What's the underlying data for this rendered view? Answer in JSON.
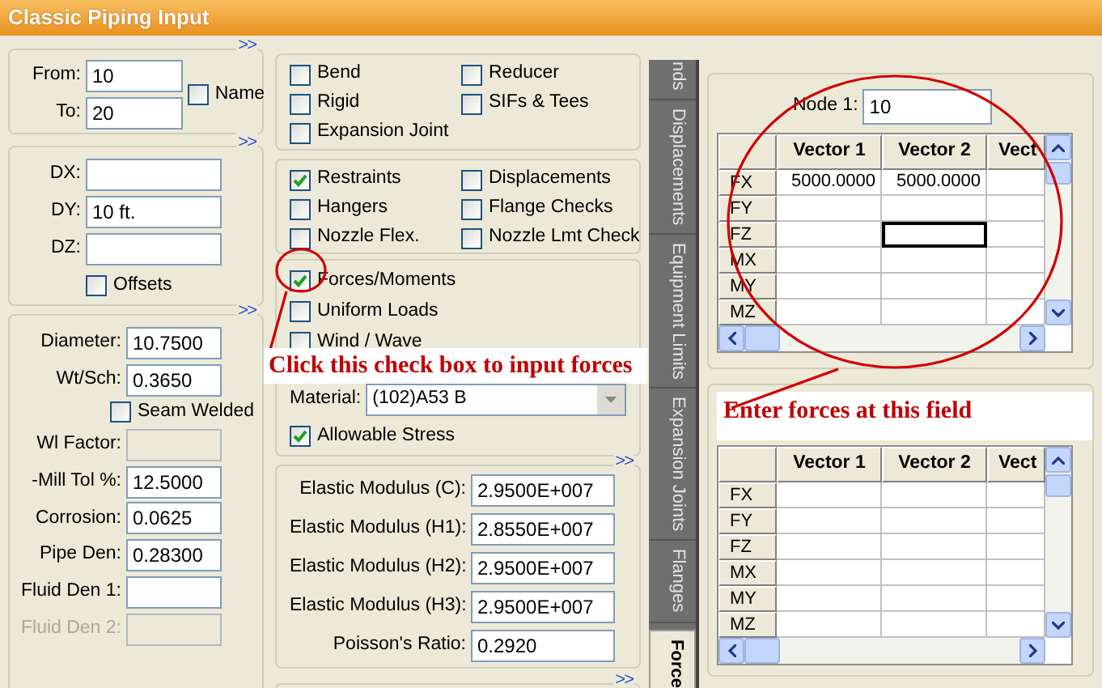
{
  "window": {
    "title": "Classic Piping Input"
  },
  "node_panel": {
    "expand": ">>",
    "fields": [
      {
        "label": "From:",
        "value": "10"
      },
      {
        "label": "To:",
        "value": "20"
      }
    ],
    "name_checkbox": {
      "label": "Name",
      "checked": false
    }
  },
  "offset_panel": {
    "expand": ">>",
    "fields": [
      {
        "label": "DX:"
      },
      {
        "label": "DY:",
        "value": "10 ft."
      },
      {
        "label": "DZ:"
      }
    ],
    "offsets_checkbox": {
      "label": "Offsets",
      "checked": false
    }
  },
  "pipe_panel": {
    "expand": ">>",
    "rows": [
      {
        "kind": "field",
        "label": "Diameter:",
        "value": "10.7500",
        "disabled": false,
        "label_dimmed": false
      },
      {
        "kind": "field",
        "label": "Wt/Sch:",
        "value": "0.3650",
        "disabled": false,
        "label_dimmed": false
      },
      {
        "kind": "checkbox",
        "label": "Seam Welded",
        "checked": false
      },
      {
        "kind": "field",
        "label": "Wl Factor:",
        "disabled": true,
        "label_dimmed": false
      },
      {
        "kind": "field",
        "label": "-Mill Tol %:",
        "value": "12.5000",
        "disabled": false,
        "label_dimmed": false
      },
      {
        "kind": "field",
        "label": "Corrosion:",
        "value": "0.0625",
        "disabled": false,
        "label_dimmed": false
      },
      {
        "kind": "field",
        "label": "Pipe Den:",
        "value": "0.28300",
        "disabled": false,
        "label_dimmed": false
      },
      {
        "kind": "field",
        "label": "Fluid Den 1:",
        "disabled": false,
        "label_dimmed": false
      },
      {
        "kind": "field",
        "label": "Fluid Den 2:",
        "disabled": true,
        "label_dimmed": true
      }
    ]
  },
  "element_options": [
    {
      "label": "Bend",
      "checked": false
    },
    {
      "label": "Reducer",
      "checked": false
    },
    {
      "label": "Rigid",
      "checked": false
    },
    {
      "label": "SIFs & Tees",
      "checked": false
    },
    {
      "label": "Expansion Joint",
      "checked": false
    }
  ],
  "boundary_options": [
    {
      "label": "Restraints",
      "checked": true
    },
    {
      "label": "Displacements",
      "checked": false
    },
    {
      "label": "Hangers",
      "checked": false
    },
    {
      "label": "Flange Checks",
      "checked": false
    },
    {
      "label": "Nozzle Flex.",
      "checked": false
    },
    {
      "label": "Nozzle Lmt Check",
      "checked": false
    }
  ],
  "load_options": [
    {
      "label": "Forces/Moments",
      "checked": true
    },
    {
      "label": "Uniform Loads",
      "checked": false
    },
    {
      "label": "Wind / Wave",
      "checked": false
    }
  ],
  "material": {
    "label": "Material:",
    "value": "(102)A53 B"
  },
  "allowable_stress": {
    "label": "Allowable Stress",
    "checked": true
  },
  "modulus_panel": {
    "expand": ">>",
    "fields": [
      {
        "label": "Elastic Modulus (C):",
        "value": "2.9500E+007"
      },
      {
        "label": "Elastic Modulus (H1):",
        "value": "2.8550E+007"
      },
      {
        "label": "Elastic Modulus (H2):",
        "value": "2.9500E+007"
      },
      {
        "label": "Elastic Modulus (H3):",
        "value": "2.9500E+007"
      },
      {
        "label": "Poisson's Ratio:",
        "value": "0.2920"
      }
    ]
  },
  "next_panel": {
    "expand": ">>"
  },
  "side_tabs": [
    {
      "label": "nds",
      "selected": false
    },
    {
      "label": "Displacements",
      "selected": false
    },
    {
      "label": "Equipment Limits",
      "selected": false
    },
    {
      "label": "Expansion Joints",
      "selected": false
    },
    {
      "label": "Flanges",
      "selected": false
    },
    {
      "label": "Force",
      "selected": true
    }
  ],
  "load_table": {
    "node_label": "Node 1:",
    "node_value": "10",
    "columns": [
      "Vector 1",
      "Vector 2",
      "Vect"
    ],
    "rows": [
      {
        "label": "FX",
        "cells": [
          {
            "value": "5000.0000",
            "focused": false
          },
          {
            "value": "5000.0000",
            "focused": false
          },
          {
            "focused": false
          }
        ]
      },
      {
        "label": "FY",
        "cells": [
          {
            "focused": false
          },
          {
            "focused": false
          },
          {
            "focused": false
          }
        ]
      },
      {
        "label": "FZ",
        "cells": [
          {
            "focused": false
          },
          {
            "focused": true
          },
          {
            "focused": false
          }
        ]
      },
      {
        "label": "MX",
        "cells": [
          {
            "focused": false
          },
          {
            "focused": false
          },
          {
            "focused": false
          }
        ]
      },
      {
        "label": "MY",
        "cells": [
          {
            "focused": false
          },
          {
            "focused": false
          },
          {
            "focused": false
          }
        ]
      },
      {
        "label": "MZ",
        "cells": [
          {
            "focused": false
          },
          {
            "focused": false
          },
          {
            "focused": false
          }
        ]
      }
    ]
  },
  "second_table": {
    "columns": [
      "Vector 1",
      "Vector 2",
      "Vect"
    ],
    "rows": [
      {
        "label": "FX"
      },
      {
        "label": "FY"
      },
      {
        "label": "FZ"
      },
      {
        "label": "MX"
      },
      {
        "label": "MY"
      },
      {
        "label": "MZ"
      }
    ]
  },
  "annotations": [
    {
      "kind": "checkbox_callout",
      "text": "Click this check box to input forces"
    },
    {
      "kind": "field_callout",
      "text": "Enter forces at this field"
    }
  ]
}
